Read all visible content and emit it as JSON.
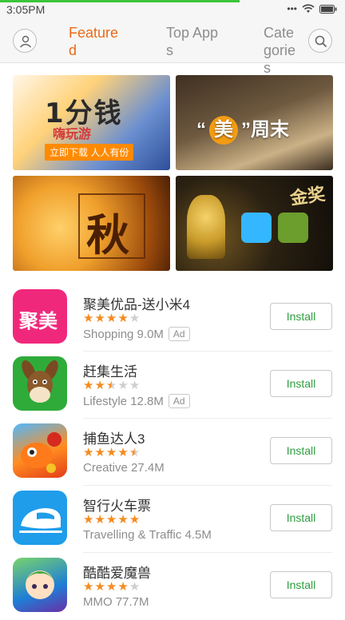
{
  "status_bar": {
    "time": "3:05PM",
    "more": "•••",
    "wifi": "wifi",
    "battery": "battery"
  },
  "header": {
    "tabs": [
      {
        "label": "Featured",
        "active": true
      },
      {
        "label": "Top Apps",
        "active": false
      },
      {
        "label": "Categories",
        "active": false
      }
    ]
  },
  "banners": [
    {
      "title": "1分钱",
      "subtitle": "嗨玩游",
      "caption": "立即下载 人人有份"
    },
    {
      "left": "“",
      "highlight": "美",
      "right": "”周末"
    },
    {
      "char": "秋"
    },
    {
      "title": "金奖"
    }
  ],
  "apps": [
    {
      "name": "聚美优品-送小米4",
      "stars": [
        1,
        1,
        1,
        1,
        0
      ],
      "meta": "Shopping 9.0M",
      "ad": "Ad",
      "install": "Install",
      "icon_text": "聚美"
    },
    {
      "name": "赶集生活",
      "stars": [
        1,
        1,
        0.5,
        0,
        0
      ],
      "meta": "Lifestyle 12.8M",
      "ad": "Ad",
      "install": "Install"
    },
    {
      "name": "捕鱼达人3",
      "stars": [
        1,
        1,
        1,
        1,
        0.5
      ],
      "meta": "Creative 27.4M",
      "install": "Install"
    },
    {
      "name": "智行火车票",
      "stars": [
        1,
        1,
        1,
        1,
        1
      ],
      "meta": "Travelling & Traffic 4.5M",
      "install": "Install"
    },
    {
      "name": "酷酷爱魔兽",
      "stars": [
        1,
        1,
        1,
        1,
        0
      ],
      "meta": "MMO 77.7M",
      "install": "Install"
    }
  ],
  "colors": {
    "accent": "#ea6a16",
    "star": "#f58b1f",
    "install_text": "#2e9d3f"
  }
}
